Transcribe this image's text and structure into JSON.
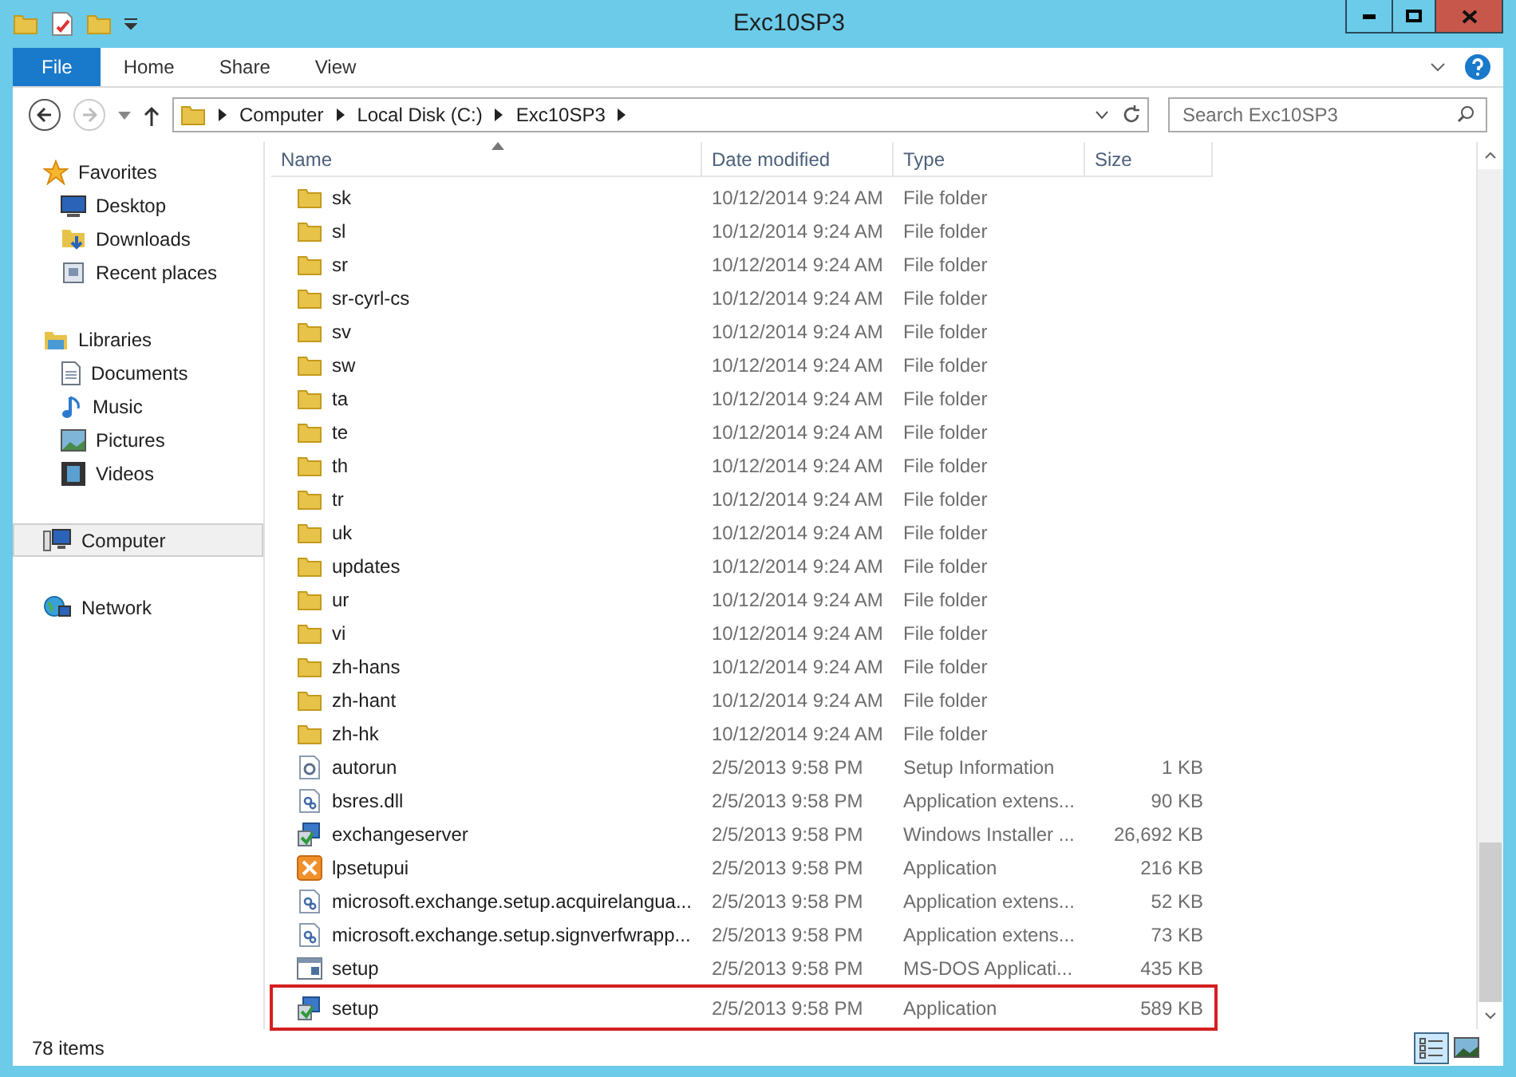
{
  "window": {
    "title": "Exc10SP3"
  },
  "ribbon_tabs": [
    {
      "label": "File",
      "selected": true
    },
    {
      "label": "Home",
      "selected": false
    },
    {
      "label": "Share",
      "selected": false
    },
    {
      "label": "View",
      "selected": false
    }
  ],
  "address": {
    "crumbs": [
      "Computer",
      "Local Disk (C:)",
      "Exc10SP3"
    ]
  },
  "search": {
    "placeholder": "Search Exc10SP3"
  },
  "sidebar": {
    "groups": [
      {
        "label": "Favorites",
        "kind": "favorites",
        "selected": false,
        "children": [
          {
            "label": "Desktop",
            "kind": "desktop",
            "selected": false
          },
          {
            "label": "Downloads",
            "kind": "downloads",
            "selected": false
          },
          {
            "label": "Recent places",
            "kind": "recent",
            "selected": false
          }
        ]
      },
      {
        "label": "Libraries",
        "kind": "libraries",
        "selected": false,
        "children": [
          {
            "label": "Documents",
            "kind": "documents",
            "selected": false
          },
          {
            "label": "Music",
            "kind": "music",
            "selected": false
          },
          {
            "label": "Pictures",
            "kind": "pictures",
            "selected": false
          },
          {
            "label": "Videos",
            "kind": "videos",
            "selected": false
          }
        ]
      },
      {
        "label": "Computer",
        "kind": "computer",
        "selected": true
      },
      {
        "label": "Network",
        "kind": "network",
        "selected": false
      }
    ]
  },
  "table": {
    "columns": [
      "Name",
      "Date modified",
      "Type",
      "Size"
    ],
    "rows": [
      {
        "name": "sk",
        "date": "10/12/2014 9:24 AM",
        "type": "File folder",
        "size": "",
        "kind": "folder",
        "highlighted": false
      },
      {
        "name": "sl",
        "date": "10/12/2014 9:24 AM",
        "type": "File folder",
        "size": "",
        "kind": "folder",
        "highlighted": false
      },
      {
        "name": "sr",
        "date": "10/12/2014 9:24 AM",
        "type": "File folder",
        "size": "",
        "kind": "folder",
        "highlighted": false
      },
      {
        "name": "sr-cyrl-cs",
        "date": "10/12/2014 9:24 AM",
        "type": "File folder",
        "size": "",
        "kind": "folder",
        "highlighted": false
      },
      {
        "name": "sv",
        "date": "10/12/2014 9:24 AM",
        "type": "File folder",
        "size": "",
        "kind": "folder",
        "highlighted": false
      },
      {
        "name": "sw",
        "date": "10/12/2014 9:24 AM",
        "type": "File folder",
        "size": "",
        "kind": "folder",
        "highlighted": false
      },
      {
        "name": "ta",
        "date": "10/12/2014 9:24 AM",
        "type": "File folder",
        "size": "",
        "kind": "folder",
        "highlighted": false
      },
      {
        "name": "te",
        "date": "10/12/2014 9:24 AM",
        "type": "File folder",
        "size": "",
        "kind": "folder",
        "highlighted": false
      },
      {
        "name": "th",
        "date": "10/12/2014 9:24 AM",
        "type": "File folder",
        "size": "",
        "kind": "folder",
        "highlighted": false
      },
      {
        "name": "tr",
        "date": "10/12/2014 9:24 AM",
        "type": "File folder",
        "size": "",
        "kind": "folder",
        "highlighted": false
      },
      {
        "name": "uk",
        "date": "10/12/2014 9:24 AM",
        "type": "File folder",
        "size": "",
        "kind": "folder",
        "highlighted": false
      },
      {
        "name": "updates",
        "date": "10/12/2014 9:24 AM",
        "type": "File folder",
        "size": "",
        "kind": "folder",
        "highlighted": false
      },
      {
        "name": "ur",
        "date": "10/12/2014 9:24 AM",
        "type": "File folder",
        "size": "",
        "kind": "folder",
        "highlighted": false
      },
      {
        "name": "vi",
        "date": "10/12/2014 9:24 AM",
        "type": "File folder",
        "size": "",
        "kind": "folder",
        "highlighted": false
      },
      {
        "name": "zh-hans",
        "date": "10/12/2014 9:24 AM",
        "type": "File folder",
        "size": "",
        "kind": "folder",
        "highlighted": false
      },
      {
        "name": "zh-hant",
        "date": "10/12/2014 9:24 AM",
        "type": "File folder",
        "size": "",
        "kind": "folder",
        "highlighted": false
      },
      {
        "name": "zh-hk",
        "date": "10/12/2014 9:24 AM",
        "type": "File folder",
        "size": "",
        "kind": "folder",
        "highlighted": false
      },
      {
        "name": "autorun",
        "date": "2/5/2013 9:58 PM",
        "type": "Setup Information",
        "size": "1 KB",
        "kind": "settings",
        "highlighted": false
      },
      {
        "name": "bsres.dll",
        "date": "2/5/2013 9:58 PM",
        "type": "Application extens...",
        "size": "90 KB",
        "kind": "library",
        "highlighted": false
      },
      {
        "name": "exchangeserver",
        "date": "2/5/2013 9:58 PM",
        "type": "Windows Installer ...",
        "size": "26,692 KB",
        "kind": "installer",
        "highlighted": false
      },
      {
        "name": "lpsetupui",
        "date": "2/5/2013 9:58 PM",
        "type": "Application",
        "size": "216 KB",
        "kind": "app",
        "highlighted": false
      },
      {
        "name": "microsoft.exchange.setup.acquirelangua...",
        "date": "2/5/2013 9:58 PM",
        "type": "Application extens...",
        "size": "52 KB",
        "kind": "library",
        "highlighted": false
      },
      {
        "name": "microsoft.exchange.setup.signverfwrapp...",
        "date": "2/5/2013 9:58 PM",
        "type": "Application extens...",
        "size": "73 KB",
        "kind": "library",
        "highlighted": false
      },
      {
        "name": "setup",
        "date": "2/5/2013 9:58 PM",
        "type": "MS-DOS Applicati...",
        "size": "435 KB",
        "kind": "console",
        "highlighted": false
      },
      {
        "name": "setup",
        "date": "2/5/2013 9:58 PM",
        "type": "Application",
        "size": "589 KB",
        "kind": "installer",
        "highlighted": true
      }
    ]
  },
  "status_bar": {
    "count": "78 items",
    "views": [
      {
        "kind": "details",
        "selected": true
      },
      {
        "kind": "thumbnails",
        "selected": false
      }
    ]
  }
}
